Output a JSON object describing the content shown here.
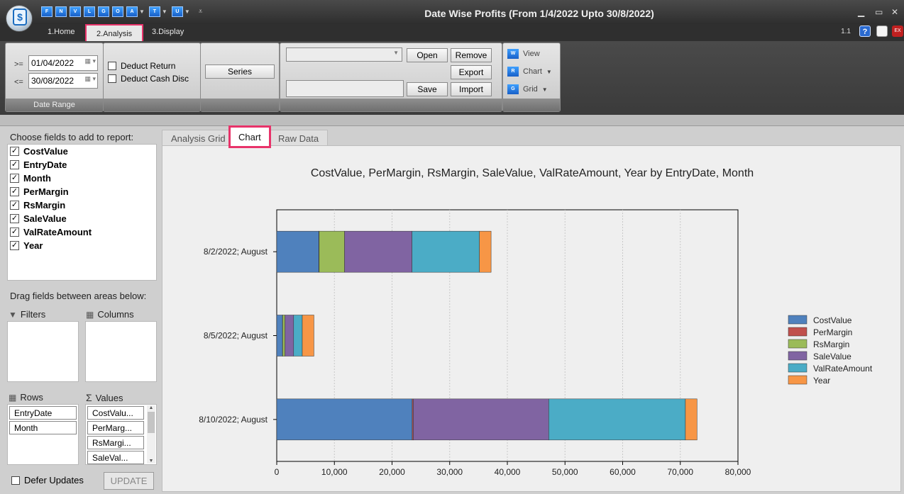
{
  "window": {
    "title": "Date Wise Profits (From 1/4/2022 Upto 30/8/2022)",
    "version": "1.1",
    "qat_icons": [
      "F",
      "N",
      "V",
      "L",
      "G",
      "O",
      "A",
      "T",
      "U"
    ]
  },
  "ribbon_tabs": [
    "1.Home",
    "2.Analysis",
    "3.Display"
  ],
  "ribbon": {
    "date_range": {
      "from_op": ">=",
      "from_value": "01/04/2022",
      "to_op": "<=",
      "to_value": "30/08/2022",
      "caption": "Date Range"
    },
    "deduct_return": "Deduct Return",
    "deduct_cash_disc": "Deduct Cash Disc",
    "series_label": "Series",
    "layout": {
      "open_label": "Open",
      "remove_label": "Remove",
      "export_label": "Export",
      "save_label": "Save",
      "import_label": "Import"
    },
    "view_items": [
      {
        "icon": "W",
        "label": "View",
        "dropdown": false
      },
      {
        "icon": "R",
        "label": "Chart",
        "dropdown": true
      },
      {
        "icon": "G",
        "label": "Grid",
        "dropdown": true
      }
    ]
  },
  "field_chooser": {
    "title": "Choose fields to add to report:",
    "fields": [
      "CostValue",
      "EntryDate",
      "Month",
      "PerMargin",
      "RsMargin",
      "SaleValue",
      "ValRateAmount",
      "Year"
    ],
    "drag_hint": "Drag fields between areas below:",
    "filters_label": "Filters",
    "columns_label": "Columns",
    "rows_label": "Rows",
    "values_label": "Values",
    "rows": [
      "EntryDate",
      "Month"
    ],
    "values": [
      "CostValu...",
      "PerMarg...",
      "RsMargi...",
      "SaleVal..."
    ],
    "defer_label": "Defer Updates",
    "update_label": "UPDATE"
  },
  "content_tabs": [
    "Analysis Grid",
    "Chart",
    "Raw Data"
  ],
  "colors": {
    "CostValue": "#4f81bd",
    "PerMargin": "#c0504d",
    "RsMargin": "#9bbb59",
    "SaleValue": "#8064a2",
    "ValRateAmount": "#4bacc6",
    "Year": "#f79646",
    "highlight": "#e8336a"
  },
  "chart_data": {
    "type": "bar",
    "orientation": "horizontal",
    "stacked": true,
    "title": "CostValue, PerMargin, RsMargin, SaleValue, ValRateAmount, Year by EntryDate, Month",
    "categories": [
      "8/2/2022; August",
      "8/5/2022; August",
      "8/10/2022; August"
    ],
    "series": [
      {
        "name": "CostValue",
        "values": [
          7300,
          1000,
          23500
        ]
      },
      {
        "name": "PerMargin",
        "values": [
          60,
          30,
          180
        ]
      },
      {
        "name": "RsMargin",
        "values": [
          4400,
          400,
          0
        ]
      },
      {
        "name": "SaleValue",
        "values": [
          11700,
          1500,
          23500
        ]
      },
      {
        "name": "ValRateAmount",
        "values": [
          11700,
          1500,
          23700
        ]
      },
      {
        "name": "Year",
        "values": [
          2022,
          2022,
          2022
        ]
      }
    ],
    "xlim": [
      0,
      80000
    ],
    "xticks": [
      "0",
      "10,000",
      "20,000",
      "30,000",
      "40,000",
      "50,000",
      "60,000",
      "70,000",
      "80,000"
    ],
    "grid": true,
    "legend": "right"
  }
}
